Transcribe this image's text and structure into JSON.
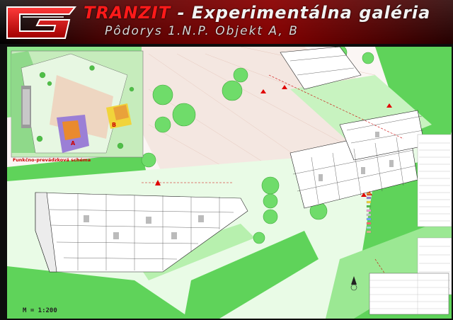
{
  "header": {
    "title_part1": "TRANZIT",
    "title_part2": " - Experimentálna galéria",
    "subtitle": "Pôdorys 1.N.P.  Objekt A, B"
  },
  "schema": {
    "label": "Funkčno-prevádzková schéma",
    "block_a": "A",
    "block_b": "B"
  },
  "scale": "M = 1:200",
  "colors": {
    "accent_red": "#ff1a1a",
    "green": "#2ecc2e",
    "light_green": "#b8f0b0"
  }
}
